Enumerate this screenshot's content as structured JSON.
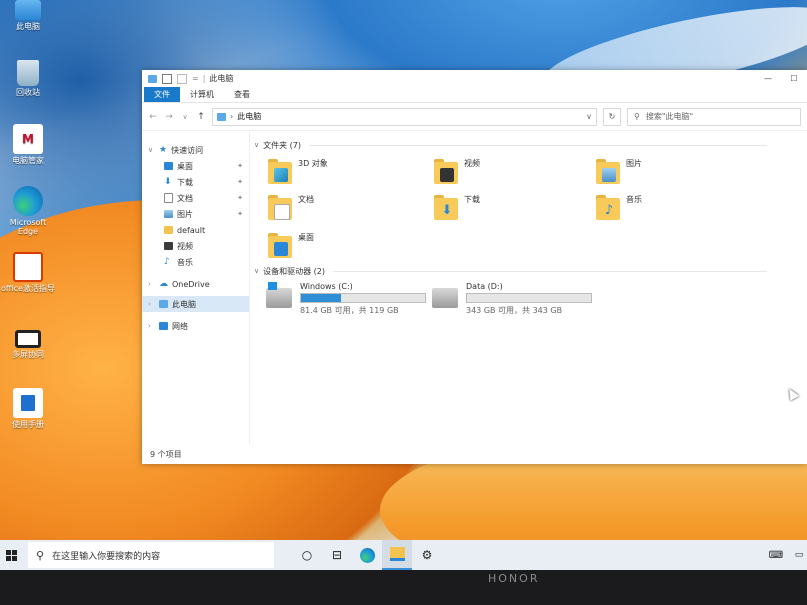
{
  "desktop": {
    "icons": [
      {
        "label": "此电脑",
        "icon": "this-pc-icon",
        "color": "#4aa3e8"
      },
      {
        "label": "回收站",
        "icon": "recycle-bin-icon",
        "color": "#8fb8d8"
      },
      {
        "label": "电脑管家",
        "icon": "pc-manager-icon",
        "color": "#ffffff"
      },
      {
        "label": "Microsoft Edge",
        "icon": "edge-icon",
        "color": "#1e9ad6"
      },
      {
        "label": "office激活指导",
        "icon": "office-guide-icon",
        "color": "#d83b01"
      },
      {
        "label": "多屏协同",
        "icon": "multi-screen-icon",
        "color": "#333333"
      },
      {
        "label": "使用手册",
        "icon": "manual-icon",
        "color": "#1f6fcf"
      }
    ]
  },
  "explorer": {
    "title": "此电脑",
    "ribbon_tabs": [
      "文件",
      "计算机",
      "查看"
    ],
    "address": "此电脑",
    "search_placeholder": "搜索\"此电脑\"",
    "nav": {
      "quick_access": "快速访问",
      "quick_items": [
        "桌面",
        "下载",
        "文档",
        "图片",
        "default",
        "视频",
        "音乐"
      ],
      "onedrive": "OneDrive",
      "this_pc": "此电脑",
      "network": "网络"
    },
    "folders_header": "文件夹 (7)",
    "folders": [
      "3D 对象",
      "视频",
      "图片",
      "文档",
      "下载",
      "音乐",
      "桌面"
    ],
    "drives_header": "设备和驱动器 (2)",
    "drives": [
      {
        "name": "Windows (C:)",
        "free": "81.4 GB 可用，共 119 GB",
        "used_fraction": 0.32
      },
      {
        "name": "Data (D:)",
        "free": "343 GB 可用，共 343 GB",
        "used_fraction": 0.0
      }
    ],
    "status": "9 个项目",
    "accent_color": "#1979ca"
  },
  "taskbar": {
    "search_placeholder": "在这里输入你要搜索的内容"
  },
  "bezel": {
    "brand": "HONOR"
  }
}
